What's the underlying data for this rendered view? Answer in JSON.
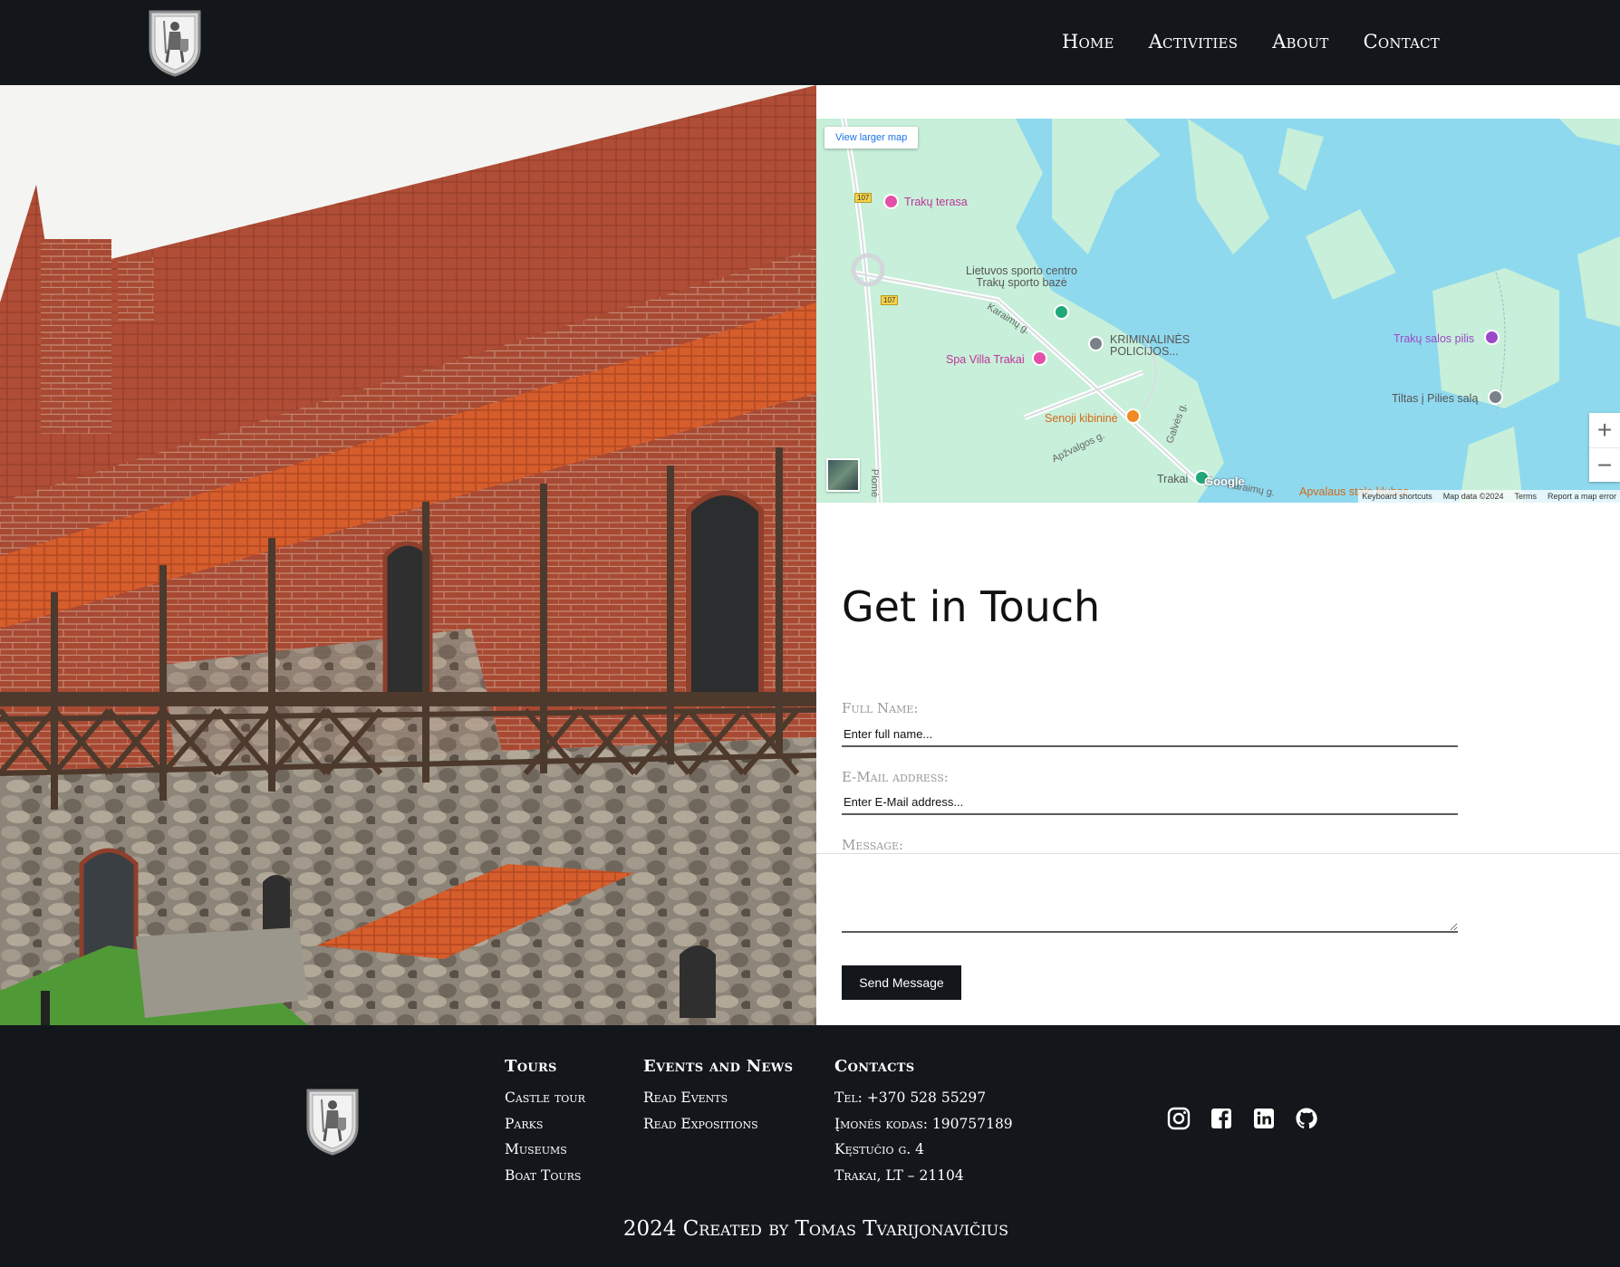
{
  "header": {
    "nav": [
      {
        "label": "Home"
      },
      {
        "label": "Activities"
      },
      {
        "label": "About"
      },
      {
        "label": "Contact"
      }
    ]
  },
  "map": {
    "view_larger": "View larger map",
    "places": [
      {
        "name": "Trakų terasa"
      },
      {
        "name": "Lietuvos sporto centro\nTrakų sporto bazė"
      },
      {
        "name": "KRIMINALINĖS\nPOLICIJOS..."
      },
      {
        "name": "Spa Villa Trakai"
      },
      {
        "name": "Senoji kibininė"
      },
      {
        "name": "Trakų salos pilis"
      },
      {
        "name": "Tiltas į Pilies salą"
      },
      {
        "name": "Trakai"
      },
      {
        "name": "Apvalaus stalo klubas"
      }
    ],
    "streets": [
      "Karaimų g.",
      "Apžvalgos g.",
      "Galvės g.",
      "Karaimų g.",
      "Plomė"
    ],
    "road_number": "107",
    "zoom_in": "+",
    "zoom_out": "−",
    "logo": "Google",
    "attribution": [
      "Keyboard shortcuts",
      "Map data ©2024",
      "Terms",
      "Report a map error"
    ]
  },
  "contact": {
    "title": "Get in Touch",
    "fields": {
      "name_label": "Full Name:",
      "name_placeholder": "Enter full name...",
      "email_label": "E-Mail address:",
      "email_placeholder": "Enter E-Mail address...",
      "message_label": "Message:"
    },
    "send_label": "Send Message"
  },
  "footer": {
    "columns": [
      {
        "title": "Tours",
        "items": [
          "Castle tour",
          "Parks",
          "Museums",
          "Boat Tours"
        ]
      },
      {
        "title": "Events and News",
        "items": [
          "Read Events",
          "Read Expositions"
        ]
      },
      {
        "title": "Contacts",
        "items": [
          "Tel: +370 528 55297",
          "Įmonės kodas: 190757189",
          "Kęstučio g. 4",
          "Trakai, LT – 21104"
        ]
      }
    ],
    "social": [
      "instagram-icon",
      "facebook-icon",
      "linkedin-icon",
      "github-icon"
    ],
    "copyright": "2024 Created by Tomas Tvarijonavičius"
  },
  "colors": {
    "dark": "#13171b",
    "water": "#8fd9ee",
    "land": "#c7efd9"
  }
}
